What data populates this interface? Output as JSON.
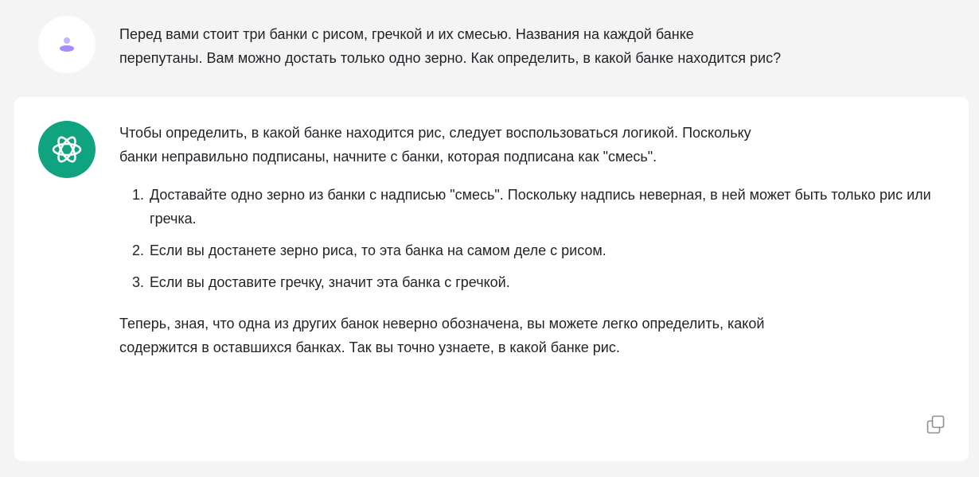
{
  "conversation": {
    "user_message": {
      "avatar_icon": "user-avatar-icon",
      "line1": "Перед вами стоит три банки с рисом, гречкой и их смесью. Названия на каждой банке",
      "line2": "перепутаны. Вам можно достать только одно зерно. Как определить, в какой банке находится рис?"
    },
    "assistant_message": {
      "avatar_icon": "openai-logo-icon",
      "intro_line1": "Чтобы определить, в какой банке находится рис, следует воспользоваться логикой. Поскольку",
      "intro_line2": "банки неправильно подписаны, начните с банки, которая подписана как \"смесь\".",
      "steps": [
        "Доставайте одно зерно из банки с надписью \"смесь\". Поскольку надпись неверная, в ней может быть только рис или гречка.",
        "Если вы достанете зерно риса, то эта банка на самом деле с рисом.",
        "Если вы доставите гречку, значит эта банка с гречкой."
      ],
      "outro_line1": "Теперь, зная, что одна из других банок неверно обозначена, вы можете легко определить, какой",
      "outro_line2": "содержится в оставшихся банках. Так вы точно узнаете, в какой банке рис.",
      "copy_icon": "copy-icon"
    }
  },
  "colors": {
    "page_background": "#f4f4f5",
    "card_background": "#ffffff",
    "assistant_avatar": "#10a37f",
    "user_icon": "#a78bfa",
    "text": "#1f2328",
    "copy_icon": "#8e8e93"
  }
}
